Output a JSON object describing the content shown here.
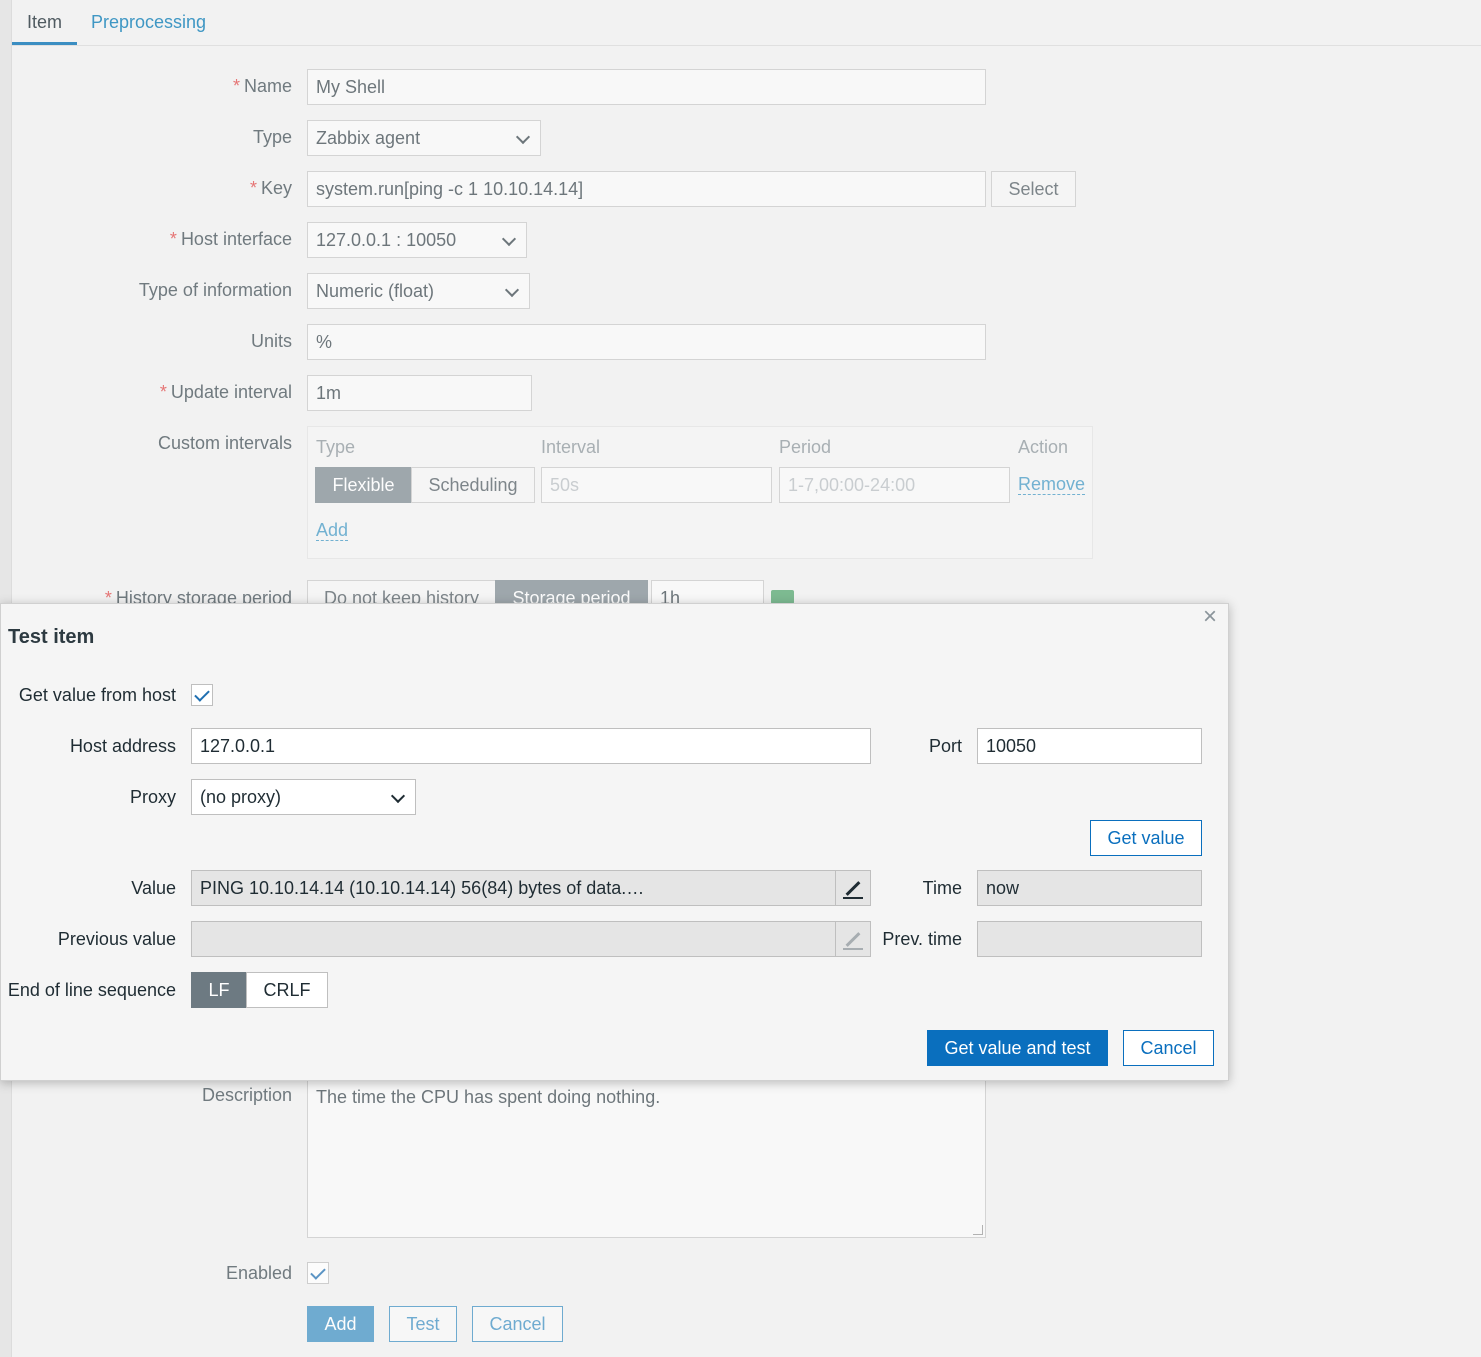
{
  "tabs": {
    "item": "Item",
    "preprocessing": "Preprocessing"
  },
  "form": {
    "name_label": "Name",
    "name_value": "My Shell",
    "type_label": "Type",
    "type_value": "Zabbix agent",
    "key_label": "Key",
    "key_value": "system.run[ping -c 1 10.10.14.14]",
    "select_button": "Select",
    "host_interface_label": "Host interface",
    "host_interface_value": "127.0.0.1 : 10050",
    "type_info_label": "Type of information",
    "type_info_value": "Numeric (float)",
    "units_label": "Units",
    "units_value": "%",
    "update_interval_label": "Update interval",
    "update_interval_value": "1m",
    "custom_intervals_label": "Custom intervals",
    "custom_intervals": {
      "headers": [
        "Type",
        "Interval",
        "Period",
        "Action"
      ],
      "flexible": "Flexible",
      "scheduling": "Scheduling",
      "interval_placeholder": "50s",
      "period_placeholder": "1-7,00:00-24:00",
      "remove": "Remove",
      "add": "Add"
    },
    "history_label": "History storage period",
    "history_do_not_keep": "Do not keep history",
    "history_storage_period": "Storage period",
    "history_value": "1h",
    "description_label": "Description",
    "description_value": "The time the CPU has spent doing nothing.",
    "enabled_label": "Enabled",
    "buttons": {
      "add": "Add",
      "test": "Test",
      "cancel": "Cancel"
    }
  },
  "dialog": {
    "title": "Test item",
    "get_value_from_host_label": "Get value from host",
    "host_address_label": "Host address",
    "host_address_value": "127.0.0.1",
    "port_label": "Port",
    "port_value": "10050",
    "proxy_label": "Proxy",
    "proxy_value": "(no proxy)",
    "get_value_button": "Get value",
    "value_label": "Value",
    "value_value": "PING 10.10.14.14 (10.10.14.14) 56(84) bytes of data.…",
    "time_label": "Time",
    "time_value": "now",
    "previous_value_label": "Previous value",
    "previous_value_value": "",
    "prev_time_label": "Prev. time",
    "prev_time_value": "",
    "eol_label": "End of line sequence",
    "eol_lf": "LF",
    "eol_crlf": "CRLF",
    "get_value_and_test_button": "Get value and test",
    "cancel_button": "Cancel",
    "close_icon": "×"
  },
  "colors": {
    "primary": "#0a6fbe",
    "link": "#3f97c4",
    "required": "#e04343",
    "segment_on": "#6d7a82"
  }
}
